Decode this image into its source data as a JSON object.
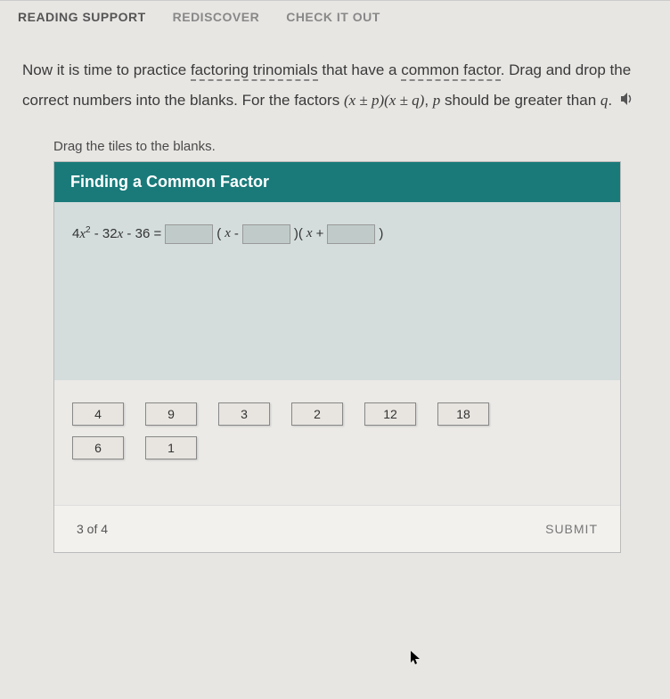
{
  "tabs": {
    "reading_support": "READING SUPPORT",
    "rediscover": "REDISCOVER",
    "check_it_out": "CHECK IT OUT"
  },
  "instructions": {
    "part1": "Now it is time to practice ",
    "keyword1": "factoring trinomials",
    "part2": " that have a ",
    "keyword2": "common factor",
    "part3": ". Drag and drop the correct numbers into the blanks. For the factors ",
    "formula": "(x ± p)(x ± q)",
    "part4": ", ",
    "var_p": "p",
    "part5": " should be greater than ",
    "var_q": "q",
    "part6": "."
  },
  "drag_hint": "Drag the tiles to the blanks.",
  "exercise": {
    "title": "Finding a Common Factor",
    "equation": {
      "lhs_a": "4",
      "lhs_var1": "x",
      "lhs_exp": "2",
      "lhs_b": " - 32",
      "lhs_var2": "x",
      "lhs_c": " - 36 = ",
      "paren1_open": "(",
      "paren1_var": "x",
      "paren1_op": " - ",
      "paren1_close": ")(",
      "paren2_var": "x",
      "paren2_op": " + ",
      "paren2_close": ")"
    }
  },
  "tiles": {
    "row1": [
      "4",
      "9",
      "3",
      "2",
      "12",
      "18"
    ],
    "row2": [
      "6",
      "1"
    ]
  },
  "footer": {
    "progress": "3 of 4",
    "submit": "SUBMIT"
  }
}
